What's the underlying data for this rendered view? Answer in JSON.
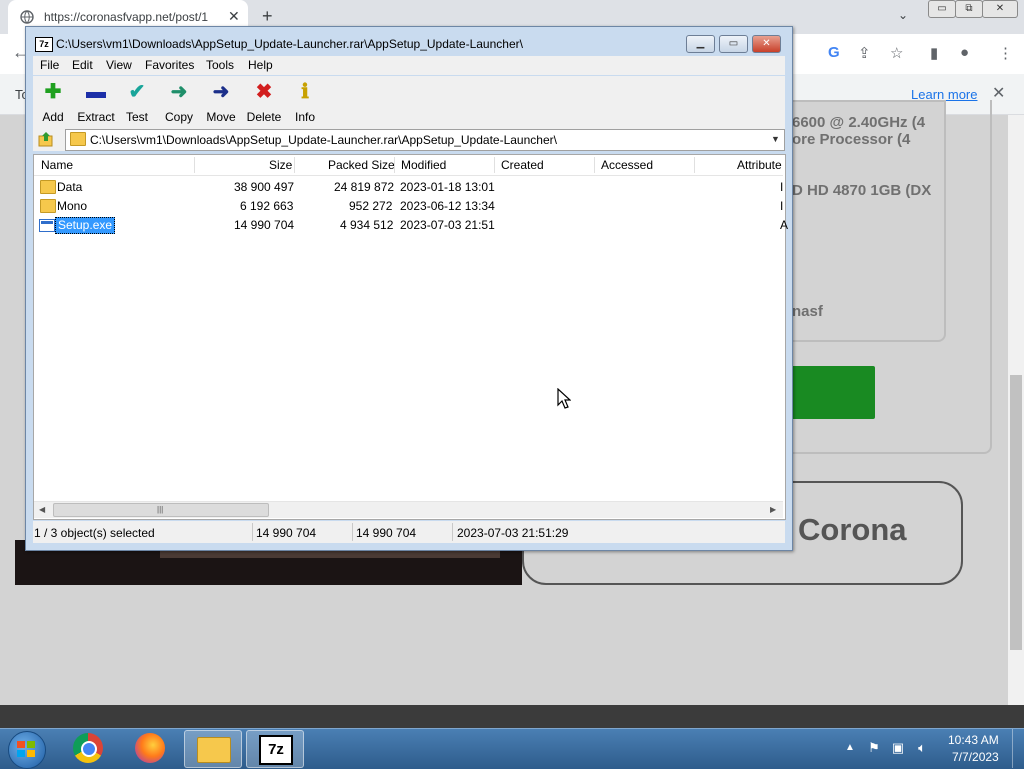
{
  "browser": {
    "tab_url": "https://coronasfvapp.net/post/1",
    "tab_close": "✕",
    "new_tab": "+",
    "tab_search": "⌄",
    "win_min": "▭",
    "win_max": "⧉",
    "win_close": "✕",
    "back": "←",
    "infobar_left": "To",
    "learn_more": "Learn more",
    "info_close": "✕"
  },
  "page": {
    "spec_lines": [
      "6600 @ 2.40GHz (4",
      "ore Processor (4",
      "D HD 4870 1GB (DX",
      "nasf"
    ],
    "corona_label": "Corona"
  },
  "zip": {
    "title": "C:\\Users\\vm1\\Downloads\\AppSetup_Update-Launcher.rar\\AppSetup_Update-Launcher\\",
    "logo": "7z",
    "menu": [
      "File",
      "Edit",
      "View",
      "Favorites",
      "Tools",
      "Help"
    ],
    "tools": [
      {
        "label": "Add",
        "glyph": "✚",
        "color": "#1fa01f"
      },
      {
        "label": "Extract",
        "glyph": "▬",
        "color": "#1c2fa8"
      },
      {
        "label": "Test",
        "glyph": "✔",
        "color": "#19a59a"
      },
      {
        "label": "Copy",
        "glyph": "➜",
        "color": "#1f8f6a"
      },
      {
        "label": "Move",
        "glyph": "➜",
        "color": "#1c2f8a"
      },
      {
        "label": "Delete",
        "glyph": "✖",
        "color": "#d21e1e"
      },
      {
        "label": "Info",
        "glyph": "ℹ",
        "color": "#c8a100"
      }
    ],
    "address": "C:\\Users\\vm1\\Downloads\\AppSetup_Update-Launcher.rar\\AppSetup_Update-Launcher\\",
    "columns": [
      "Name",
      "Size",
      "Packed Size",
      "Modified",
      "Created",
      "Accessed",
      "Attribute"
    ],
    "rows": [
      {
        "name": "Data",
        "size": "38 900 497",
        "packed": "24 819 872",
        "modified": "2023-01-18 13:01",
        "attr": "I"
      },
      {
        "name": "Mono",
        "size": "6 192 663",
        "packed": "952 272",
        "modified": "2023-06-12 13:34",
        "attr": "I"
      },
      {
        "name": "Setup.exe",
        "size": "14 990 704",
        "packed": "4 934 512",
        "modified": "2023-07-03 21:51",
        "attr": "A"
      }
    ],
    "status": {
      "selected": "1 / 3 object(s) selected",
      "size": "14 990 704",
      "packed": "14 990 704",
      "modified": "2023-07-03 21:51:29"
    },
    "scroll_grip": "|||"
  },
  "taskbar": {
    "zip_label": "7z",
    "tray_up": "▲",
    "clock_time": "10:43 AM",
    "clock_date": "7/7/2023"
  },
  "colors": {
    "selection": "#3399ff",
    "taskbar": "#2e5c8c",
    "green_button": "#198a22"
  }
}
